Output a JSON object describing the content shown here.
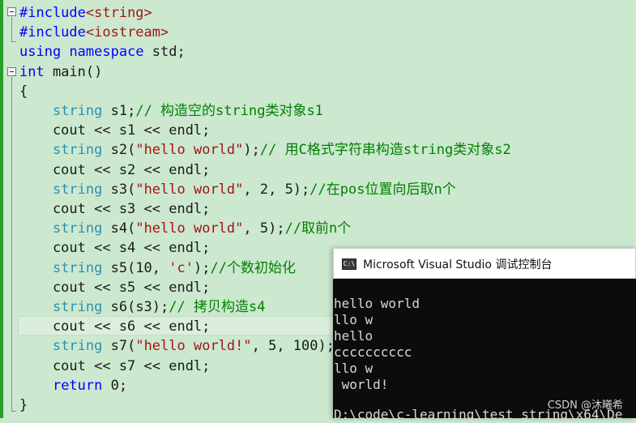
{
  "editor": {
    "lines": [
      {
        "parts": [
          {
            "c": "kw",
            "t": "#include"
          },
          {
            "c": "str",
            "t": "<string>"
          }
        ]
      },
      {
        "parts": [
          {
            "c": "kw",
            "t": "#include"
          },
          {
            "c": "str",
            "t": "<iostream>"
          }
        ]
      },
      {
        "parts": [
          {
            "c": "kw",
            "t": "using"
          },
          {
            "c": "",
            "t": " "
          },
          {
            "c": "kw",
            "t": "namespace"
          },
          {
            "c": "",
            "t": " std;"
          }
        ]
      },
      {
        "parts": [
          {
            "c": "kw",
            "t": "int"
          },
          {
            "c": "",
            "t": " main()"
          }
        ]
      },
      {
        "parts": [
          {
            "c": "",
            "t": "{"
          }
        ]
      },
      {
        "parts": [
          {
            "c": "",
            "t": "    "
          },
          {
            "c": "typ",
            "t": "string"
          },
          {
            "c": "",
            "t": " s1;"
          },
          {
            "c": "cmt",
            "t": "// 构造空的string类对象s1"
          }
        ]
      },
      {
        "parts": [
          {
            "c": "",
            "t": "    cout << s1 << endl;"
          }
        ]
      },
      {
        "parts": [
          {
            "c": "",
            "t": "    "
          },
          {
            "c": "typ",
            "t": "string"
          },
          {
            "c": "",
            "t": " s2("
          },
          {
            "c": "str",
            "t": "\"hello world\""
          },
          {
            "c": "",
            "t": ");"
          },
          {
            "c": "cmt",
            "t": "// 用C格式字符串构造string类对象s2"
          }
        ]
      },
      {
        "parts": [
          {
            "c": "",
            "t": "    cout << s2 << endl;"
          }
        ]
      },
      {
        "parts": [
          {
            "c": "",
            "t": "    "
          },
          {
            "c": "typ",
            "t": "string"
          },
          {
            "c": "",
            "t": " s3("
          },
          {
            "c": "str",
            "t": "\"hello world\""
          },
          {
            "c": "",
            "t": ", 2, 5);"
          },
          {
            "c": "cmt",
            "t": "//在pos位置向后取n个"
          }
        ]
      },
      {
        "parts": [
          {
            "c": "",
            "t": "    cout << s3 << endl;"
          }
        ]
      },
      {
        "parts": [
          {
            "c": "",
            "t": "    "
          },
          {
            "c": "typ",
            "t": "string"
          },
          {
            "c": "",
            "t": " s4("
          },
          {
            "c": "str",
            "t": "\"hello world\""
          },
          {
            "c": "",
            "t": ", 5);"
          },
          {
            "c": "cmt",
            "t": "//取前n个"
          }
        ]
      },
      {
        "parts": [
          {
            "c": "",
            "t": "    cout << s4 << endl;"
          }
        ]
      },
      {
        "parts": [
          {
            "c": "",
            "t": "    "
          },
          {
            "c": "typ",
            "t": "string"
          },
          {
            "c": "",
            "t": " s5(10, "
          },
          {
            "c": "str",
            "t": "'c'"
          },
          {
            "c": "",
            "t": ");"
          },
          {
            "c": "cmt",
            "t": "//个数初始化"
          }
        ]
      },
      {
        "parts": [
          {
            "c": "",
            "t": "    cout << s5 << endl;"
          }
        ]
      },
      {
        "parts": [
          {
            "c": "",
            "t": "    "
          },
          {
            "c": "typ",
            "t": "string"
          },
          {
            "c": "",
            "t": " s6(s3);"
          },
          {
            "c": "cmt",
            "t": "// 拷贝构造s4"
          }
        ]
      },
      {
        "parts": [
          {
            "c": "",
            "t": "    cout << s6 << endl;"
          }
        ]
      },
      {
        "parts": [
          {
            "c": "",
            "t": "    "
          },
          {
            "c": "typ",
            "t": "string"
          },
          {
            "c": "",
            "t": " s7("
          },
          {
            "c": "str",
            "t": "\"hello world!\""
          },
          {
            "c": "",
            "t": ", 5, 100);"
          }
        ]
      },
      {
        "parts": [
          {
            "c": "",
            "t": "    cout << s7 << endl;"
          }
        ]
      },
      {
        "parts": [
          {
            "c": "",
            "t": "    "
          },
          {
            "c": "kw",
            "t": "return"
          },
          {
            "c": "",
            "t": " 0;"
          }
        ]
      },
      {
        "parts": [
          {
            "c": "",
            "t": "}"
          }
        ]
      }
    ]
  },
  "console": {
    "title": "Microsoft Visual Studio 调试控制台",
    "icon_text": "C:\\",
    "output": [
      "hello world",
      "llo w",
      "hello",
      "cccccccccc",
      "llo w",
      " world!",
      "",
      "D:\\code\\c-learning\\test_string\\x64\\De"
    ]
  },
  "watermark": "CSDN @沐曦希",
  "colors": {
    "background": "#cce8cf",
    "keyword": "#0000ff",
    "type": "#2b91af",
    "string": "#a31515",
    "comment": "#008000",
    "console_bg": "#0c0c0c"
  }
}
